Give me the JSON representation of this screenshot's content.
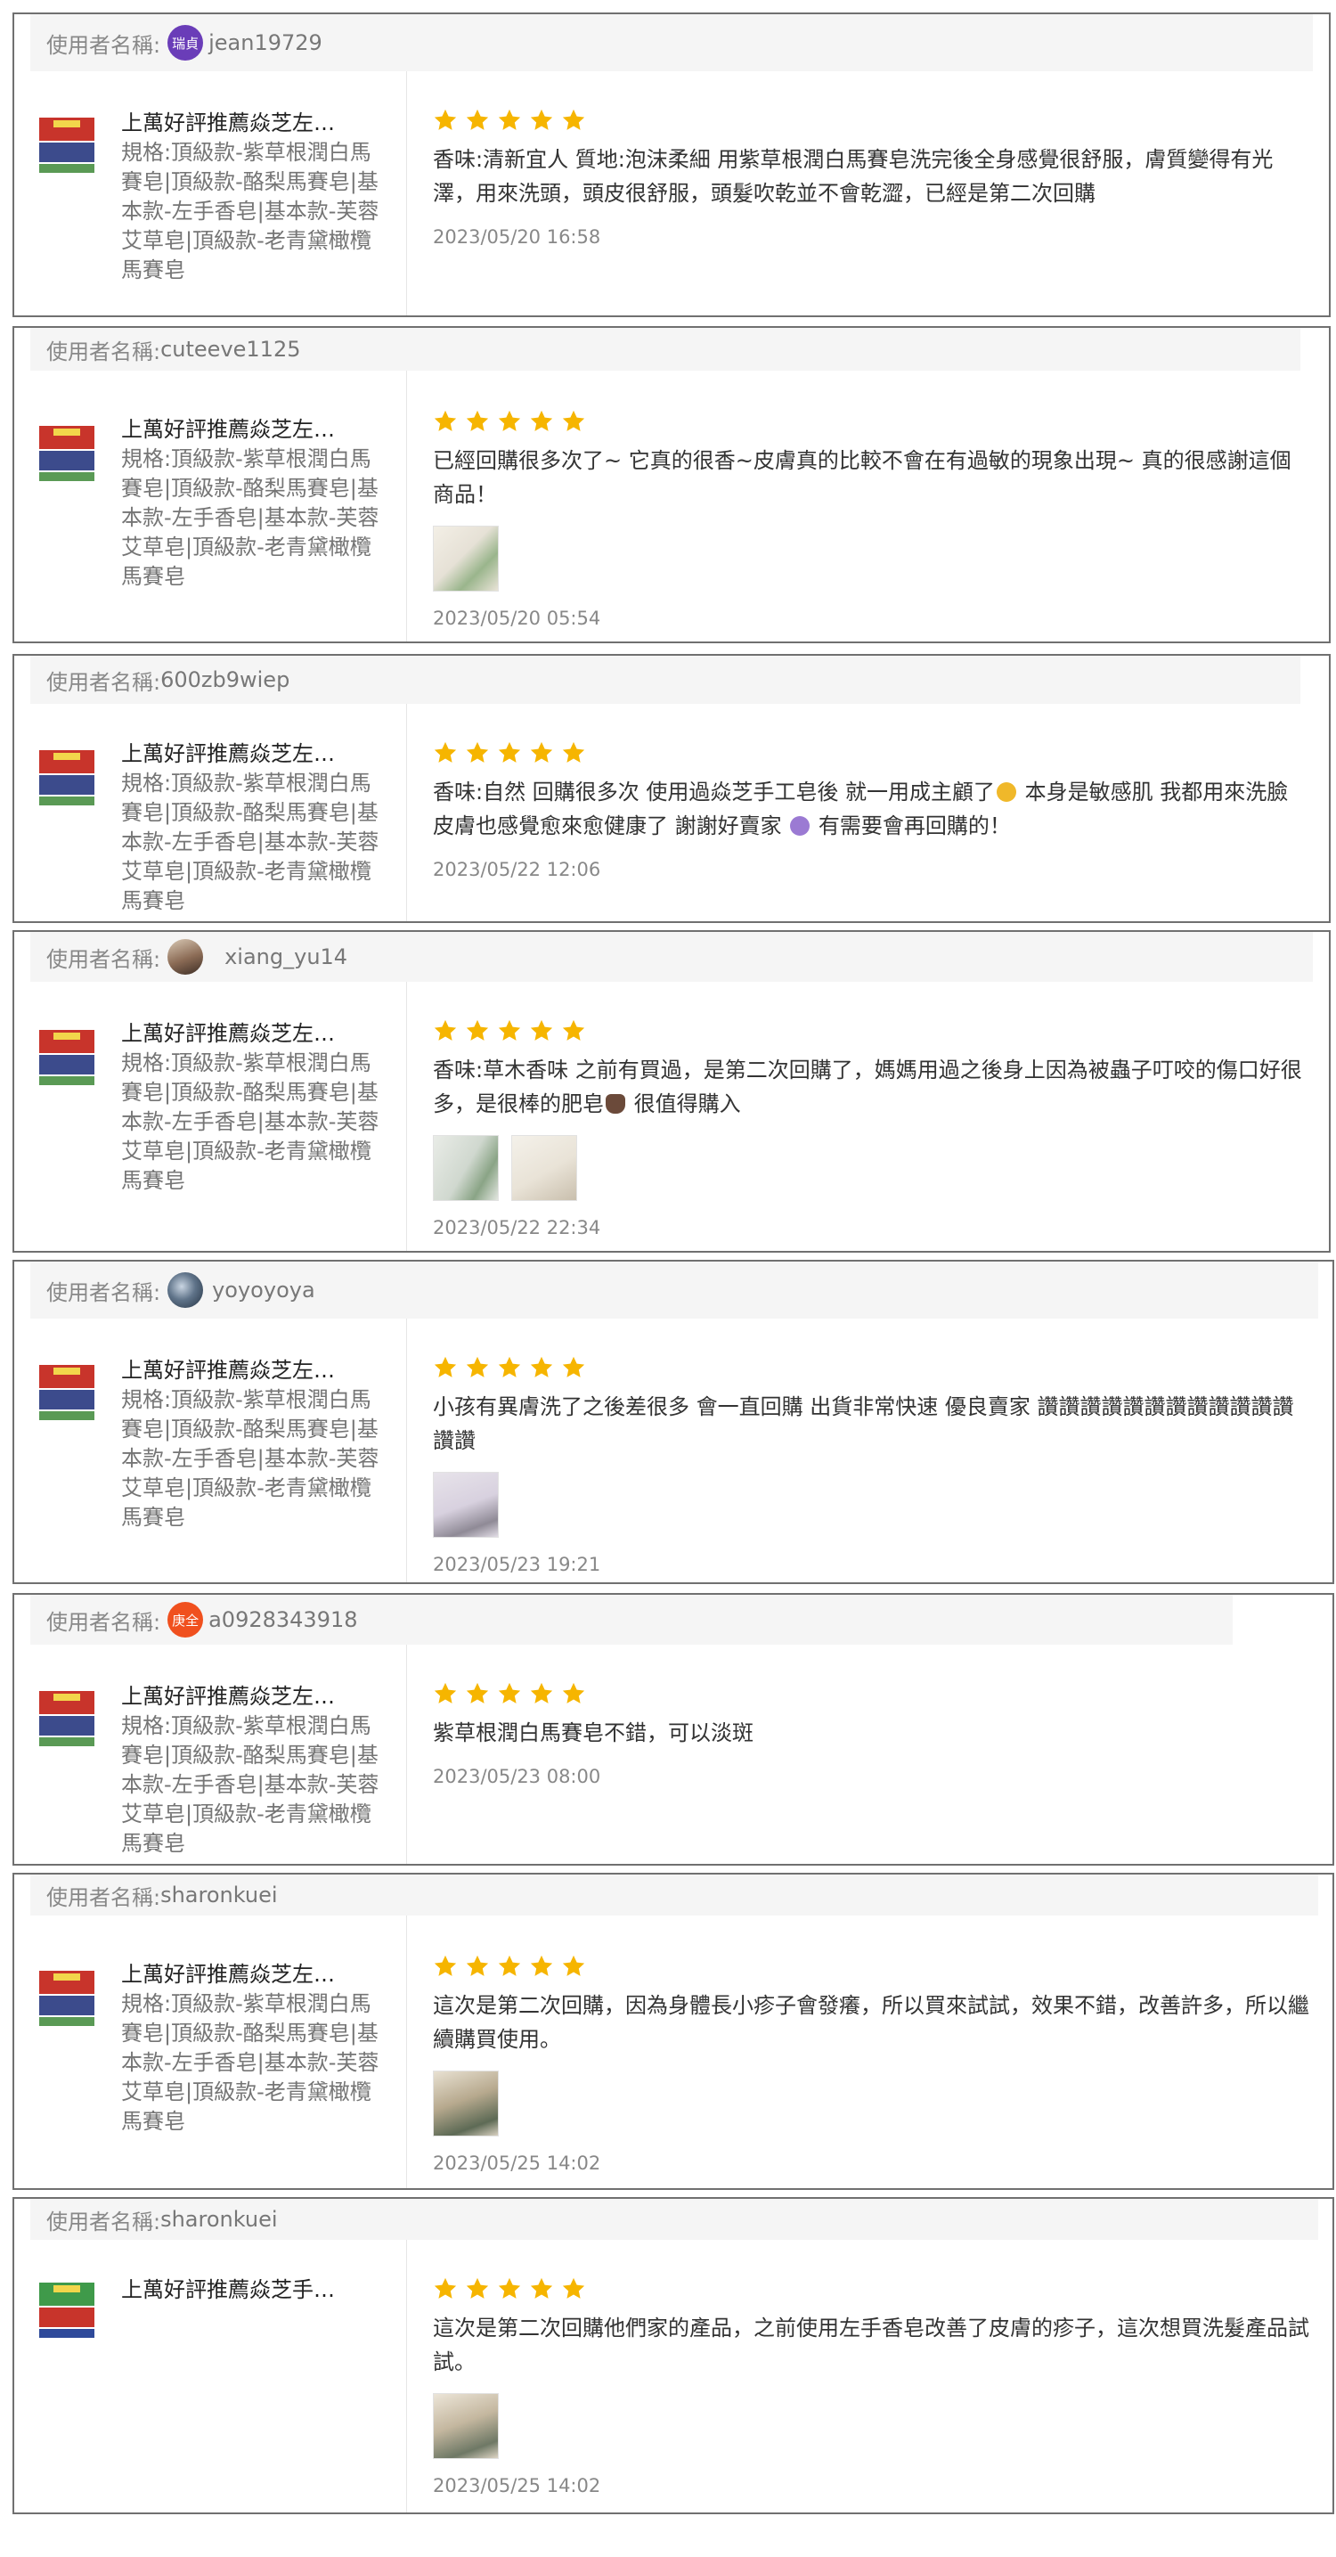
{
  "user_label": "使用者名稱:",
  "reviews": [
    {
      "username": "jean19729",
      "avatar_text": "瑞貞",
      "avatar_color": "#6a3db8",
      "product_title": "上萬好評推薦焱芝左…",
      "product_spec": "規格:頂級款-紫草根潤白馬賽皂|頂級款-酪梨馬賽皂|基本款-左手香皂|基本款-芙蓉艾草皂|頂級款-老青黛橄欖馬賽皂",
      "rating": 5,
      "text": "香味:清新宜人 質地:泡沫柔細 用紫草根潤白馬賽皂洗完後全身感覺很舒服，膚質變得有光澤，用來洗頭，頭皮很舒服，頭髮吹乾並不會乾澀，已經是第二次回購",
      "time": "2023/05/20 16:58"
    },
    {
      "username": "cuteeve1125",
      "product_title": "上萬好評推薦焱芝左…",
      "product_spec": "規格:頂級款-紫草根潤白馬賽皂|頂級款-酪梨馬賽皂|基本款-左手香皂|基本款-芙蓉艾草皂|頂級款-老青黛橄欖馬賽皂",
      "rating": 5,
      "text": "已經回購很多次了~ 它真的很香~皮膚真的比較不會在有過敏的現象出現~ 真的很感謝這個商品！",
      "photos": 1,
      "time": "2023/05/20 05:54"
    },
    {
      "username": "600zb9wiep",
      "product_title": "上萬好評推薦焱芝左…",
      "product_spec": "規格:頂級款-紫草根潤白馬賽皂|頂級款-酪梨馬賽皂|基本款-左手香皂|基本款-芙蓉艾草皂|頂級款-老青黛橄欖馬賽皂",
      "rating": 5,
      "text_1": "香味:自然 回購很多次 使用過焱芝手工皂後 就一用成主顧了",
      "text_2": " 本身是敏感肌 我都用來洗臉 皮膚也感覺愈來愈健康了 謝謝好賣家 ",
      "text_3": " 有需要會再回購的！",
      "time": "2023/05/22 12:06"
    },
    {
      "username": "xiang_yu14",
      "product_title": "上萬好評推薦焱芝左…",
      "product_spec": "規格:頂級款-紫草根潤白馬賽皂|頂級款-酪梨馬賽皂|基本款-左手香皂|基本款-芙蓉艾草皂|頂級款-老青黛橄欖馬賽皂",
      "rating": 5,
      "text_1": "香味:草木香味 之前有買過，是第二次回購了，媽媽用過之後身上因為被蟲子叮咬的傷口好很多，是很棒的肥皂",
      "text_2": " 很值得購入",
      "photos": 2,
      "time": "2023/05/22 22:34"
    },
    {
      "username": "yoyoyoya",
      "product_title": "上萬好評推薦焱芝左…",
      "product_spec": "規格:頂級款-紫草根潤白馬賽皂|頂級款-酪梨馬賽皂|基本款-左手香皂|基本款-芙蓉艾草皂|頂級款-老青黛橄欖馬賽皂",
      "rating": 5,
      "text": "小孩有異膚洗了之後差很多 會一直回購 出貨非常快速 優良賣家 讚讚讚讚讚讚讚讚讚讚讚讚讚讚",
      "photos": 1,
      "time": "2023/05/23 19:21"
    },
    {
      "username": "a0928343918",
      "avatar_text": "庚全",
      "avatar_color": "#f0501e",
      "product_title": "上萬好評推薦焱芝左…",
      "product_spec": "規格:頂級款-紫草根潤白馬賽皂|頂級款-酪梨馬賽皂|基本款-左手香皂|基本款-芙蓉艾草皂|頂級款-老青黛橄欖馬賽皂",
      "rating": 5,
      "text": "紫草根潤白馬賽皂不錯，可以淡斑",
      "time": "2023/05/23 08:00"
    },
    {
      "username": "sharonkuei",
      "product_title": "上萬好評推薦焱芝左…",
      "product_spec": "規格:頂級款-紫草根潤白馬賽皂|頂級款-酪梨馬賽皂|基本款-左手香皂|基本款-芙蓉艾草皂|頂級款-老青黛橄欖馬賽皂",
      "rating": 5,
      "text": "這次是第二次回購，因為身體長小疹子會發癢，所以買來試試，效果不錯，改善許多，所以繼續購買使用。",
      "photos": 1,
      "time": "2023/05/25 14:02"
    },
    {
      "username": "sharonkuei",
      "product_title": "上萬好評推薦焱芝手…",
      "rating": 5,
      "text": "這次是第二次回購他們家的產品，之前使用左手香皂改善了皮膚的疹子，這次想買洗髮產品試試。",
      "photos": 1,
      "time": "2023/05/25 14:02"
    }
  ],
  "colors": {
    "star": "#f6b500",
    "border": "#707070",
    "header_bg": "#f5f5f5"
  }
}
